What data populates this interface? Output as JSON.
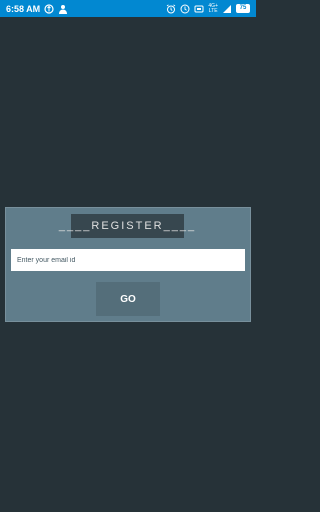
{
  "status_bar": {
    "time": "6:58 AM",
    "battery": "75",
    "network_top": "4G+",
    "network_bottom": "LTE",
    "left_icons": [
      "data-saver-icon",
      "person-icon"
    ],
    "right_icons": [
      "alarm-icon",
      "clock-icon",
      "network-icon",
      "signal-icon",
      "battery-icon"
    ]
  },
  "register": {
    "title": "____REGISTER____",
    "email_placeholder": "Enter your email id",
    "email_value": "",
    "go_label": "GO"
  },
  "colors": {
    "background": "#263238",
    "status_bar": "#0288d1",
    "card": "#607d8b",
    "title_box": "#37474f",
    "button": "#546e7a"
  }
}
